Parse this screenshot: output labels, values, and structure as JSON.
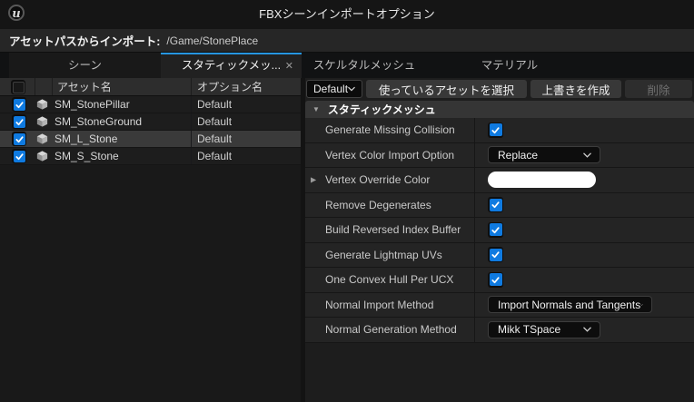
{
  "icons": {
    "close": "✕",
    "collapse": "▼",
    "expand": "▶",
    "unreal_logo": "u"
  },
  "colors": {
    "accent_blue": "#0f7ae0",
    "active_tab_highlight": "#2695e0"
  },
  "titlebar": {
    "title": "FBXシーンインポートオプション"
  },
  "path_bar": {
    "label": "アセットパスからインポート:",
    "path": "/Game/StonePlace"
  },
  "tabs": {
    "left": [
      {
        "label": "シーン",
        "active": false
      },
      {
        "label": "スタティックメッ...",
        "active": true,
        "closable": true
      }
    ],
    "right": [
      {
        "label": "スケルタルメッシュ"
      },
      {
        "label": "マテリアル"
      }
    ]
  },
  "asset_table": {
    "columns": [
      "アセット名",
      "オプション名"
    ],
    "rows": [
      {
        "name": "SM_StonePillar",
        "option": "Default",
        "checked": true,
        "selected": false
      },
      {
        "name": "SM_StoneGround",
        "option": "Default",
        "checked": true,
        "selected": false
      },
      {
        "name": "SM_L_Stone",
        "option": "Default",
        "checked": true,
        "selected": true
      },
      {
        "name": "SM_S_Stone",
        "option": "Default",
        "checked": true,
        "selected": false
      }
    ]
  },
  "toolbar": {
    "profile_dropdown_value": "Default",
    "select_used_assets_label": "使っているアセットを選択",
    "create_override_label": "上書きを作成",
    "delete_label": "削除",
    "delete_enabled": false
  },
  "details": {
    "section_title": "スタティックメッシュ",
    "rows": [
      {
        "label": "Generate Missing Collision",
        "type": "checkbox",
        "checked": true
      },
      {
        "label": "Vertex Color Import Option",
        "type": "dropdown",
        "value": "Replace"
      },
      {
        "label": "Vertex Override Color",
        "type": "color",
        "value": "#ffffff",
        "expandable": true
      },
      {
        "label": "Remove Degenerates",
        "type": "checkbox",
        "checked": true
      },
      {
        "label": "Build Reversed Index Buffer",
        "type": "checkbox",
        "checked": true
      },
      {
        "label": "Generate Lightmap UVs",
        "type": "checkbox",
        "checked": true
      },
      {
        "label": "One Convex Hull Per UCX",
        "type": "checkbox",
        "checked": true
      },
      {
        "label": "Normal Import Method",
        "type": "dropdown",
        "value": "Import Normals and Tangents",
        "wide": true
      },
      {
        "label": "Normal Generation Method",
        "type": "dropdown",
        "value": "Mikk TSpace"
      }
    ]
  }
}
